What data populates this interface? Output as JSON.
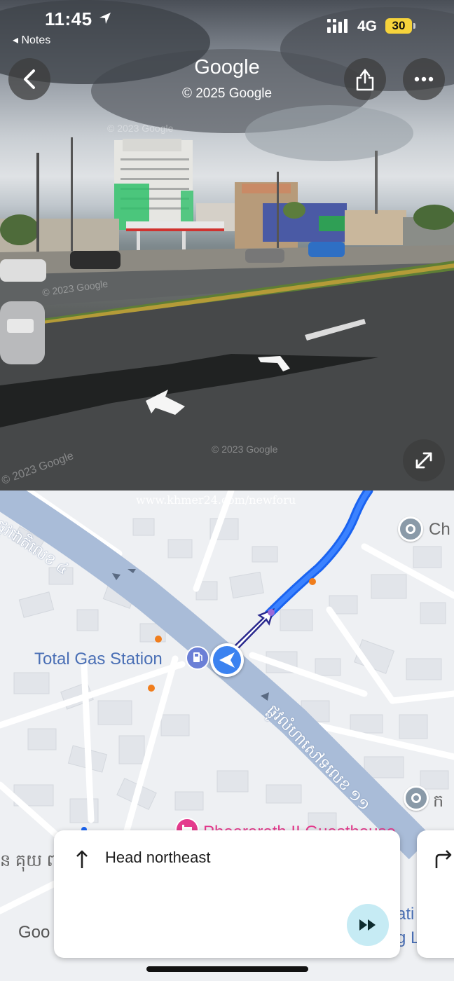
{
  "status_bar": {
    "time": "11:45",
    "back_app": "◂ Notes",
    "network": "4G",
    "battery": "30"
  },
  "street_view": {
    "title": "Google",
    "copyright": "© 2025 Google",
    "watermarks": [
      "© 2023 Google",
      "© 2023 Google",
      "© 2023 Google",
      "© 2023 Google"
    ],
    "icons": {
      "back": "chevron-left-icon",
      "share": "share-icon",
      "more": "more-horizontal-icon",
      "expand": "expand-icon"
    }
  },
  "map": {
    "watermark": "www.khmer24.com/newforu",
    "road_labels": [
      "ផ្លូវជាតិលេខ ៤",
      "ផ្លូវលំហាសៅទលេខ ១១"
    ],
    "places": {
      "gas_station": "Total Gas Station",
      "ch": "Ch",
      "right_kh": "ក",
      "guesthouse": "Phearareth II Guesthouse",
      "ati": "ati",
      "g_l": "g L",
      "left_kh": "ន គុយ ព",
      "google_logo": "Goo"
    },
    "colors": {
      "route": "#1a63f0",
      "road": "#a9bcd8",
      "location": "#3b82f0"
    }
  },
  "direction_card": {
    "instruction": "Head northeast",
    "arrow_icon": "arrow-up-icon",
    "play_icon": "fast-forward-icon"
  },
  "next_card": {
    "arrow_icon": "turn-right-icon"
  }
}
